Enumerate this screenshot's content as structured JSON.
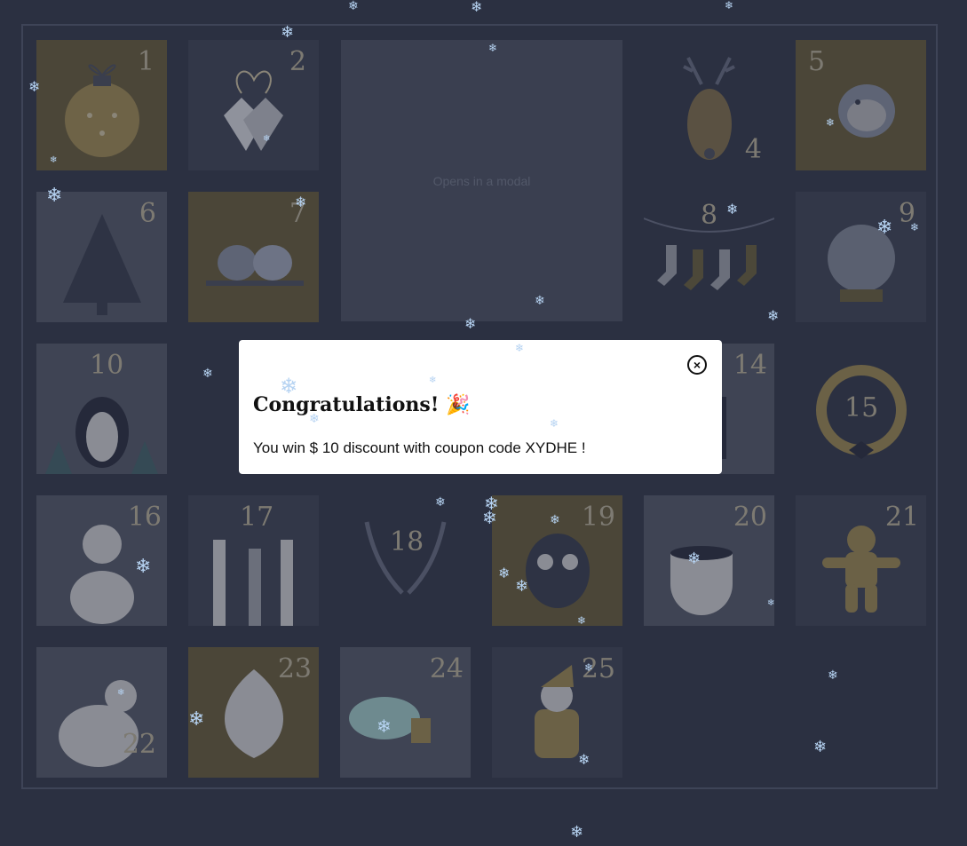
{
  "calendar": {
    "big_tile_text": "Opens in a modal",
    "tiles": [
      {
        "day": "1",
        "theme": "gold"
      },
      {
        "day": "2",
        "theme": "dark"
      },
      {
        "day": "4",
        "theme": "none"
      },
      {
        "day": "5",
        "theme": "gold"
      },
      {
        "day": "6",
        "theme": "light"
      },
      {
        "day": "7",
        "theme": "gold"
      },
      {
        "day": "8",
        "theme": "none"
      },
      {
        "day": "9",
        "theme": "dark"
      },
      {
        "day": "10",
        "theme": "light"
      },
      {
        "day": "14",
        "theme": "light"
      },
      {
        "day": "15",
        "theme": "none"
      },
      {
        "day": "16",
        "theme": "light"
      },
      {
        "day": "17",
        "theme": "dark"
      },
      {
        "day": "18",
        "theme": "none"
      },
      {
        "day": "19",
        "theme": "gold"
      },
      {
        "day": "20",
        "theme": "light"
      },
      {
        "day": "21",
        "theme": "dark"
      },
      {
        "day": "22",
        "theme": "light"
      },
      {
        "day": "23",
        "theme": "gold"
      },
      {
        "day": "24",
        "theme": "light"
      },
      {
        "day": "25",
        "theme": "dark"
      }
    ]
  },
  "modal": {
    "title": "Congratulations!",
    "title_emoji": "🎉",
    "message": "You win $ 10 discount with coupon code XYDHE !",
    "close_icon": "close-circle-icon"
  },
  "snowflake_glyph": "❄"
}
